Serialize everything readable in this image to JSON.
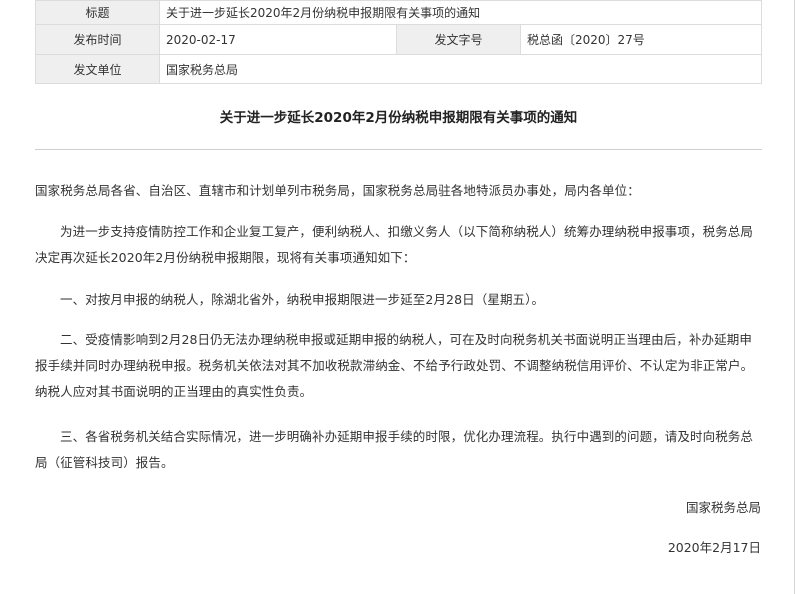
{
  "meta": {
    "title_label": "标题",
    "title_value": "关于进一步延长2020年2月份纳税申报期限有关事项的通知",
    "date_label": "发布时间",
    "date_value": "2020-02-17",
    "docno_label": "发文字号",
    "docno_value": "税总函〔2020〕27号",
    "issuer_label": "发文单位",
    "issuer_value": "国家税务总局"
  },
  "document": {
    "title": "关于进一步延长2020年2月份纳税申报期限有关事项的通知",
    "salutation": "国家税务总局各省、自治区、直辖市和计划单列市税务局，国家税务总局驻各地特派员办事处，局内各单位：",
    "paragraphs": [
      "为进一步支持疫情防控工作和企业复工复产，便利纳税人、扣缴义务人（以下简称纳税人）统筹办理纳税申报事项，税务总局决定再次延长2020年2月份纳税申报期限，现将有关事项通知如下：",
      "一、对按月申报的纳税人，除湖北省外，纳税申报期限进一步延至2月28日（星期五）。",
      "二、受疫情影响到2月28日仍无法办理纳税申报或延期申报的纳税人，可在及时向税务机关书面说明正当理由后，补办延期申报手续并同时办理纳税申报。税务机关依法对其不加收税款滞纳金、不给予行政处罚、不调整纳税信用评价、不认定为非正常户。纳税人应对其书面说明的正当理由的真实性负责。",
      "三、各省税务机关结合实际情况，进一步明确补办延期申报手续的时限，优化办理流程。执行中遇到的问题，请及时向税务总局（征管科技司）报告。"
    ],
    "signature": "国家税务总局",
    "sign_date": "2020年2月17日"
  }
}
